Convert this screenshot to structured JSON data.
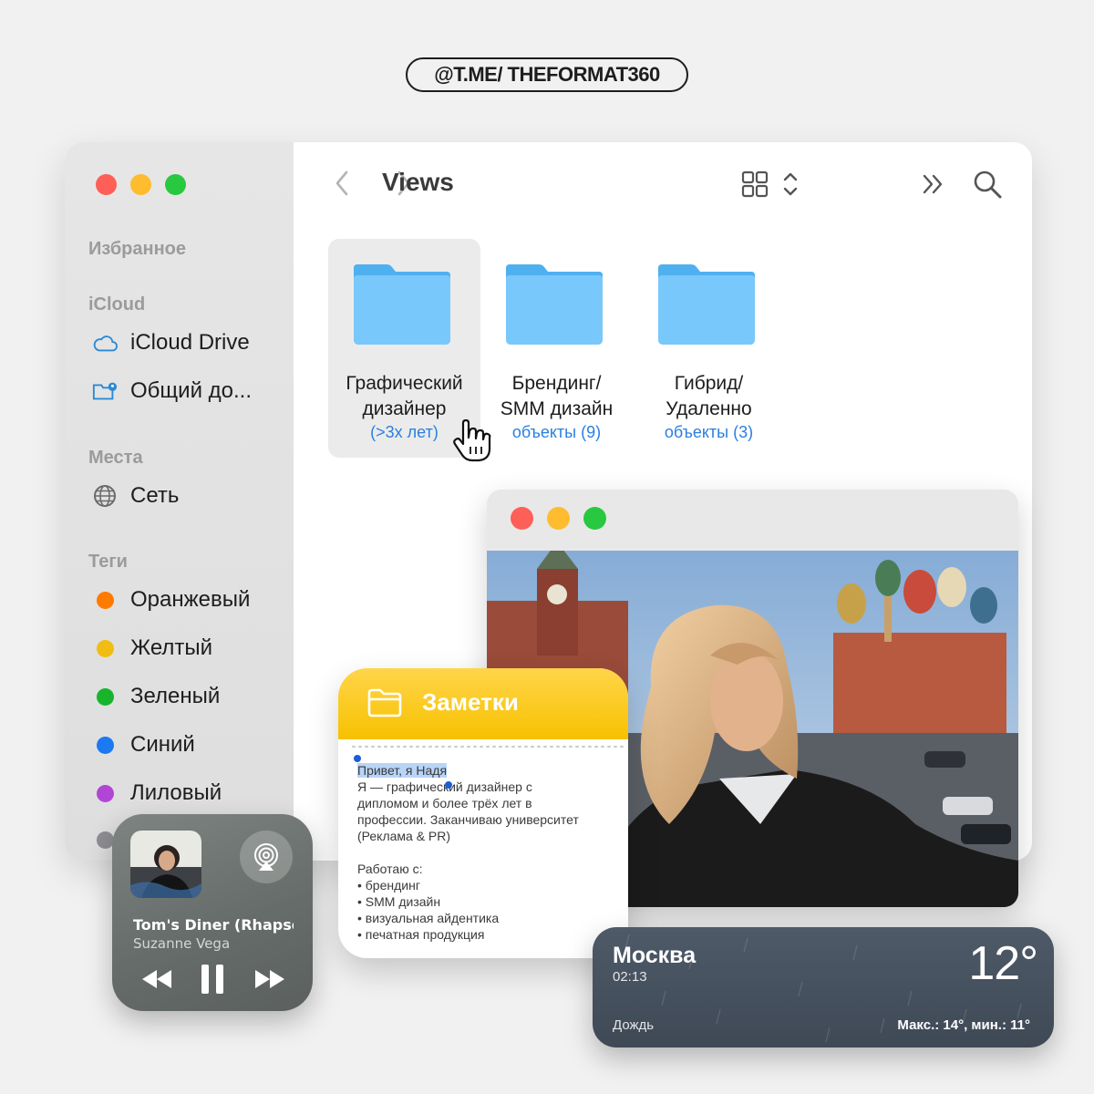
{
  "handle": "@T.ME/ THEFORMAT360",
  "finder": {
    "title": "Views",
    "sidebar": {
      "favorites_heading": "Избранное",
      "icloud_heading": "iCloud",
      "icloud_items": [
        {
          "label": "iCloud Drive",
          "icon": "cloud-icon"
        },
        {
          "label": "Общий до...",
          "icon": "shared-folder-icon"
        }
      ],
      "places_heading": "Места",
      "places_items": [
        {
          "label": "Сеть",
          "icon": "globe-icon"
        }
      ],
      "tags_heading": "Теги",
      "tags": [
        {
          "label": "Оранжевый",
          "color": "#ff7b00"
        },
        {
          "label": "Желтый",
          "color": "#f2bd12"
        },
        {
          "label": "Зеленый",
          "color": "#18b52c"
        },
        {
          "label": "Синий",
          "color": "#1b79f2"
        },
        {
          "label": "Лиловый",
          "color": "#b146d6"
        }
      ]
    },
    "folders": [
      {
        "name_line1": "Графический",
        "name_line2": "дизайнер",
        "subtitle": "(>3x лет)",
        "selected": true
      },
      {
        "name_line1": "Брендинг/",
        "name_line2": "SMM дизайн",
        "subtitle": "объекты (9)",
        "selected": false
      },
      {
        "name_line1": "Гибрид/",
        "name_line2": "Удаленно",
        "subtitle": "объекты (3)",
        "selected": false
      }
    ]
  },
  "notes": {
    "title": "Заметки",
    "greeting": "Привет, я Надя",
    "lines": [
      "Я — графический дизайнер с",
      "дипломом и более трёх лет в",
      "профессии. Заканчиваю университет",
      "(Реклама & PR)"
    ],
    "work_heading": "Работаю с:",
    "work_items": [
      "• брендинг",
      "• SMM дизайн",
      "• визуальная айдентика",
      "• печатная продукция"
    ]
  },
  "music": {
    "track": "Tom's Diner (Rhapsody)",
    "artist": "Suzanne Vega"
  },
  "weather": {
    "city": "Москва",
    "time": "02:13",
    "temperature": "12°",
    "condition": "Дождь",
    "range": "Макс.: 14°, мин.: 11°"
  }
}
